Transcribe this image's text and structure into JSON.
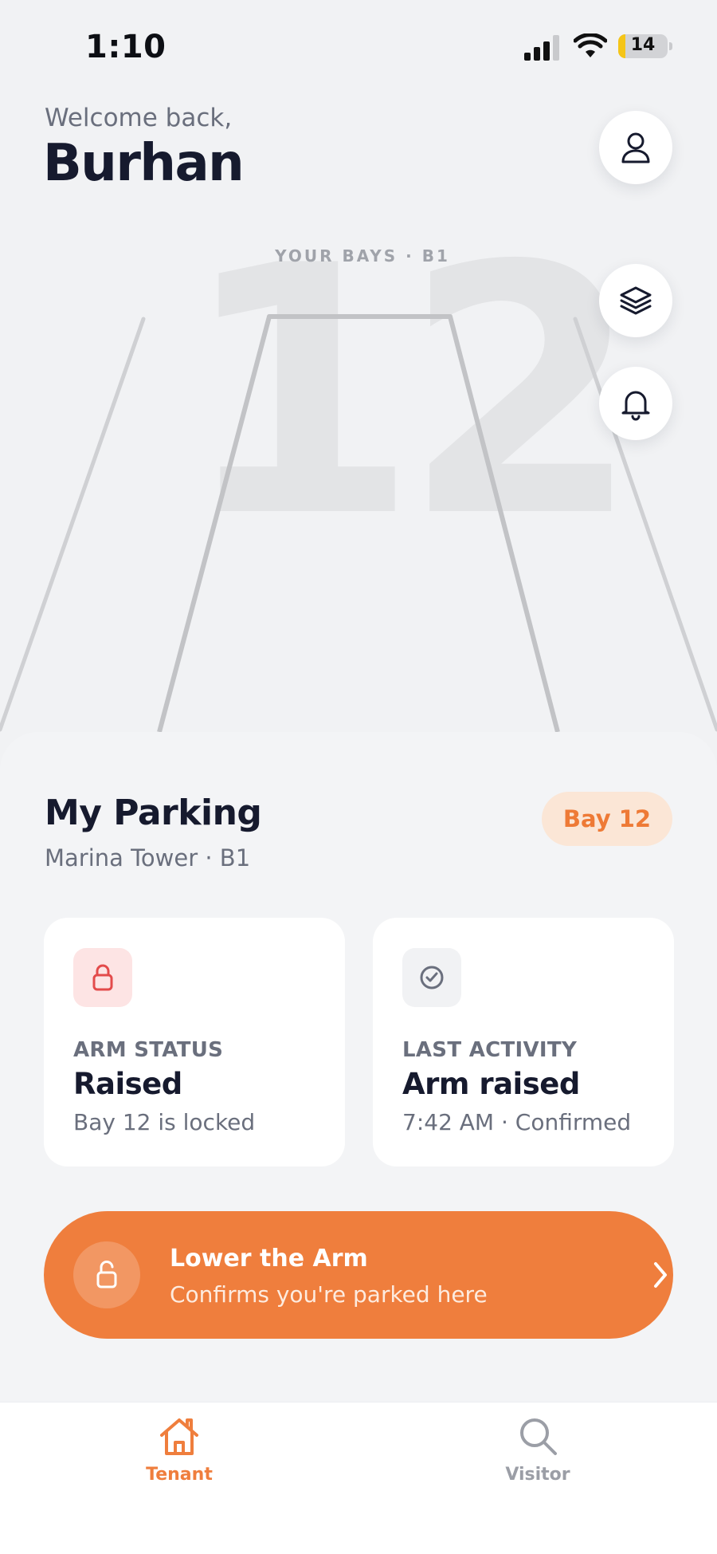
{
  "status_bar": {
    "time": "1:10",
    "battery": "14",
    "battery_fraction": 0.14
  },
  "header": {
    "welcome": "Welcome back,",
    "name": "Burhan"
  },
  "icons": {
    "profile": "user-icon",
    "layers": "layers-icon",
    "notifications": "bell-icon"
  },
  "visual": {
    "bays_label": "YOUR BAYS · B1",
    "bay_number": "12"
  },
  "parking": {
    "title": "My Parking",
    "location": "Marina Tower · B1",
    "bay_badge": "Bay 12",
    "arm_status": {
      "kicker": "ARM STATUS",
      "value": "Raised",
      "detail": "Bay 12 is locked",
      "icon": "lock-icon"
    },
    "last_activity": {
      "kicker": "LAST ACTIVITY",
      "value": "Arm raised",
      "detail": "7:42 AM · Confirmed",
      "icon": "check-circle-icon"
    }
  },
  "cta": {
    "title": "Lower the Arm",
    "subtitle": "Confirms you're parked here",
    "icon": "unlock-icon"
  },
  "tabs": [
    {
      "label": "Tenant",
      "icon": "home-icon",
      "active": true
    },
    {
      "label": "Visitor",
      "icon": "search-icon",
      "active": false
    }
  ],
  "colors": {
    "accent": "#ef7e3d",
    "badge_bg": "#fbe6d6",
    "lock_red": "#e34b4b",
    "text_dark": "#161a2e",
    "text_muted": "#6a6f7d"
  }
}
